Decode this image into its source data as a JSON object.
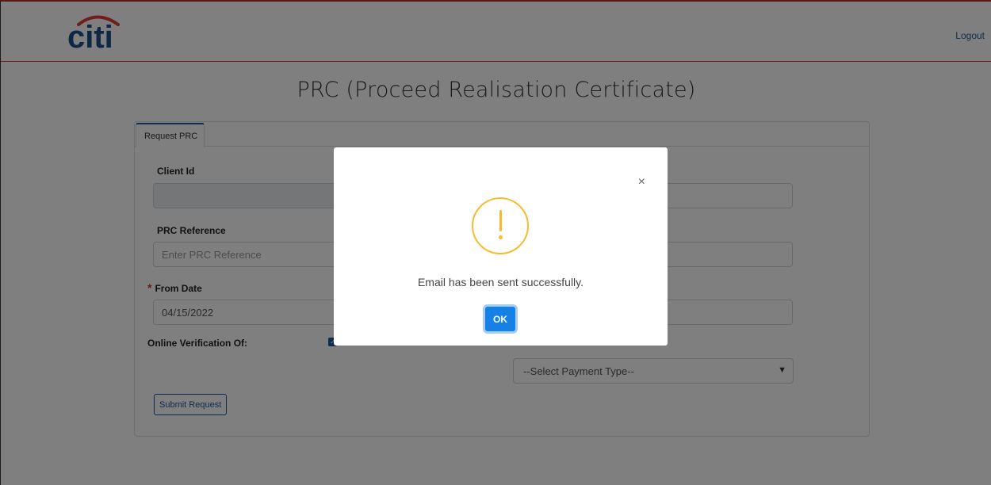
{
  "header": {
    "brand": "citi",
    "logout": "Logout"
  },
  "page": {
    "title": "PRC (Proceed Realisation Certificate)"
  },
  "card": {
    "tab": "Request PRC",
    "client_id_label": "Client Id",
    "prc_reference_label": "PRC Reference",
    "prc_reference_placeholder": "Enter PRC Reference",
    "from_date_required": "*",
    "from_date_label": "From Date",
    "from_date_value": "04/15/2022",
    "online_verification_label": "Online Verification Of:",
    "payment_type_value": "--Select Payment Type--",
    "submit_label": "Submit Request"
  },
  "modal": {
    "message": "Email has been sent successfully.",
    "ok_label": "OK",
    "close_glyph": "×"
  },
  "colors": {
    "brand_blue": "#1b5a9a",
    "brand_red": "#e33a35",
    "warning": "#f8bb2e",
    "ok_button": "#1580e6"
  }
}
